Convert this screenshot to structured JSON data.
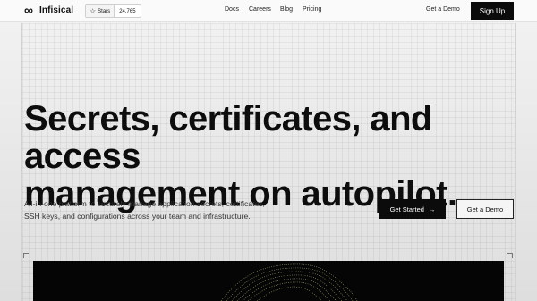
{
  "brand": {
    "name": "Infisical",
    "logo_icon": "infinity-icon"
  },
  "github": {
    "label": "Stars",
    "count": "24,765",
    "icon": "star-icon"
  },
  "nav": {
    "items": [
      "Docs",
      "Careers",
      "Blog",
      "Pricing"
    ]
  },
  "header": {
    "demo_label": "Get a Demo",
    "signup_label": "Sign Up"
  },
  "hero": {
    "headline_line1": "Secrets, certificates, and access",
    "headline_line2": "management on autopilot.",
    "subtitle_line1": "All-in-one platform to securely manage application secrets, certificates,",
    "subtitle_line2": "SSH keys, and configurations across your team and infrastructure.",
    "cta_primary": "Get Started",
    "cta_primary_icon": "arrow-right-icon",
    "cta_secondary": "Get a Demo"
  },
  "colors": {
    "accent": "#0b0b0b",
    "background": "#eeeeee",
    "particle": "#d8e8a0"
  }
}
